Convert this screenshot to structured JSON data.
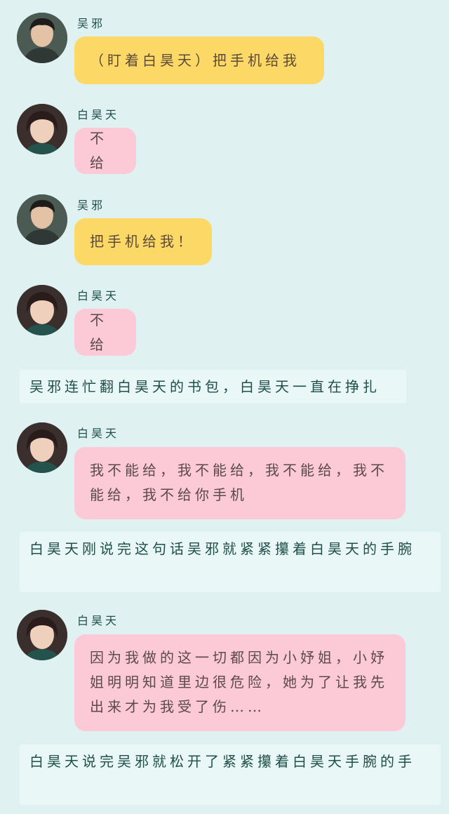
{
  "messages": [
    {
      "speaker": "吴邪",
      "text": "（盯着白昊天）把手机给我"
    },
    {
      "speaker": "白昊天",
      "text": "不给"
    },
    {
      "speaker": "吴邪",
      "text": "把手机给我！"
    },
    {
      "speaker": "白昊天",
      "text": "不给"
    },
    {
      "narration": "吴邪连忙翻白昊天的书包，白昊天一直在挣扎"
    },
    {
      "speaker": "白昊天",
      "text": "我不能给，我不能给，我不能给，我不能给，我不给你手机"
    },
    {
      "narration": "白昊天刚说完这句话吴邪就紧紧攥着白昊天的手腕"
    },
    {
      "speaker": "白昊天",
      "text": "因为我做的这一切都因为小妤姐，小妤姐明明知道里边很危险，她为了让我先出来才为我受了伤……"
    },
    {
      "narration": "白昊天说完吴邪就松开了紧紧攥着白昊天手腕的手"
    }
  ],
  "colors": {
    "background": "#dff1f0",
    "wuxie_bubble": "#fcd967",
    "bai_bubble": "#fcc9d6",
    "narration_bg": "#eaf7f7"
  }
}
